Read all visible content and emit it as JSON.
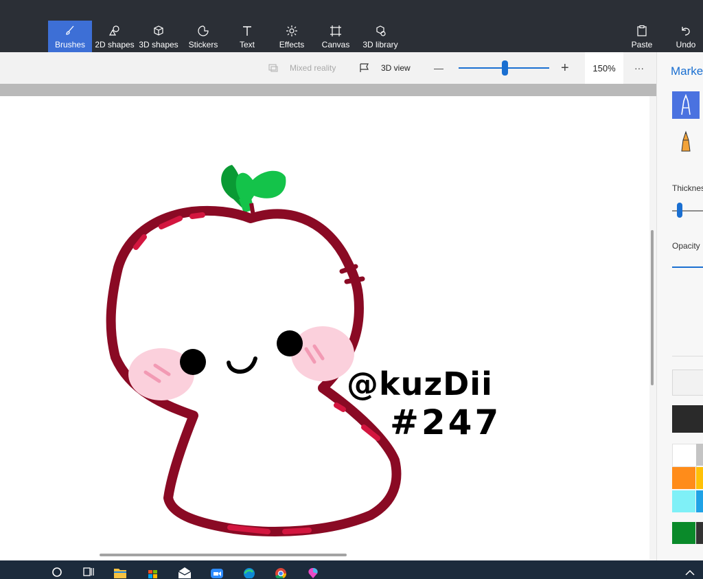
{
  "ribbon": {
    "tools": [
      {
        "label": "Brushes",
        "icon": "brush-icon"
      },
      {
        "label": "2D shapes",
        "icon": "2d-shapes-icon"
      },
      {
        "label": "3D shapes",
        "icon": "3d-shapes-icon"
      },
      {
        "label": "Stickers",
        "icon": "stickers-icon"
      },
      {
        "label": "Text",
        "icon": "text-icon"
      },
      {
        "label": "Effects",
        "icon": "effects-icon"
      },
      {
        "label": "Canvas",
        "icon": "canvas-icon"
      },
      {
        "label": "3D library",
        "icon": "3d-library-icon"
      }
    ],
    "paste_label": "Paste",
    "undo_label": "Undo",
    "active_color": "#3d6fd6"
  },
  "subbar": {
    "mixed_reality_label": "Mixed reality",
    "view_3d_label": "3D view",
    "zoom_minus": "—",
    "zoom_plus": "+",
    "zoom_level": "150%",
    "more": "···"
  },
  "canvas": {
    "signature_line1": "@kuzDii",
    "signature_line2": "#247",
    "outline_color": "#8a0a24",
    "leaf_color": "#14c34a"
  },
  "panel": {
    "title": "Marker",
    "thickness_label": "Thickness",
    "opacity_label": "Opacity",
    "accent": "#1a6fd1",
    "swatches": [
      "#ffffff",
      "#2a2a2a",
      "#ff8c1a",
      "#7ff0f7",
      "#0a8a2a"
    ]
  },
  "taskbar": {
    "icons": [
      "cortana-icon",
      "task-view-icon",
      "file-explorer-icon",
      "store-icon",
      "mail-icon",
      "zoom-icon",
      "edge-icon",
      "chrome-icon",
      "paint3d-icon",
      "chevron-up-icon"
    ]
  }
}
